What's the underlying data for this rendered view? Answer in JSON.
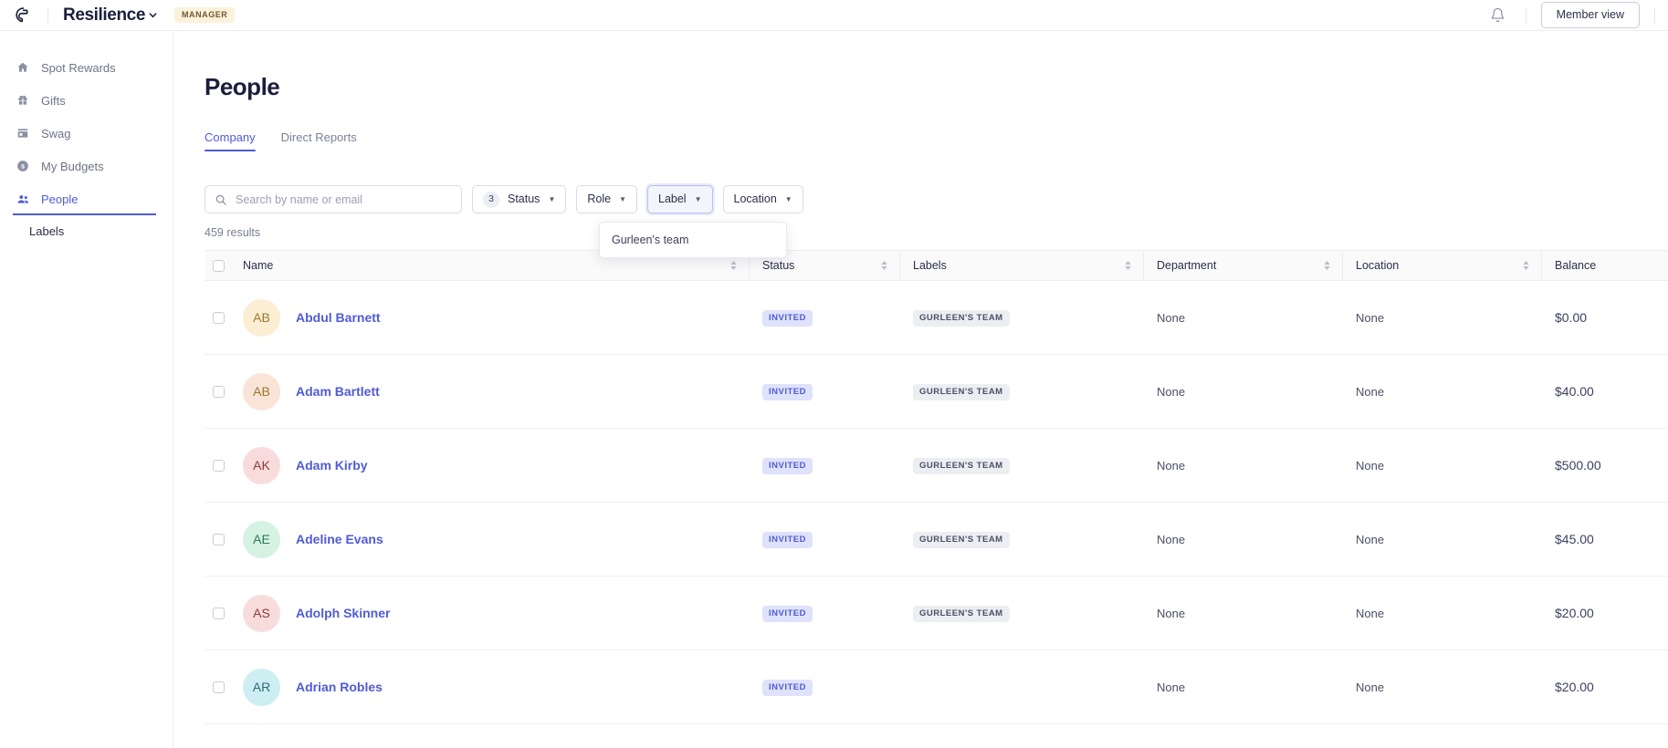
{
  "topbar": {
    "logo_icon": "resilience-logo-icon",
    "brand_name": "Resilience",
    "brand_caret_icon": "chevron-down-icon",
    "role_pill": "MANAGER",
    "bell_icon": "notification-bell-icon",
    "member_view_label": "Member view"
  },
  "sidebar": {
    "items": [
      {
        "label": "Spot Rewards",
        "icon": "home-icon",
        "active": false
      },
      {
        "label": "Gifts",
        "icon": "gift-icon",
        "active": false
      },
      {
        "label": "Swag",
        "icon": "store-icon",
        "active": false
      },
      {
        "label": "My Budgets",
        "icon": "dollar-circle-icon",
        "active": false
      },
      {
        "label": "People",
        "icon": "people-icon",
        "active": true
      }
    ],
    "sub_item": "Labels"
  },
  "page": {
    "title": "People",
    "tabs": [
      {
        "label": "Company",
        "active": true
      },
      {
        "label": "Direct Reports",
        "active": false
      }
    ]
  },
  "filters": {
    "search": {
      "placeholder": "Search by name or email",
      "value": "",
      "icon": "search-icon"
    },
    "status": {
      "label": "Status",
      "count": "3",
      "caret_icon": "caret-down-icon"
    },
    "role": {
      "label": "Role",
      "caret_icon": "caret-down-icon"
    },
    "label": {
      "label": "Label",
      "caret_icon": "caret-down-icon",
      "open": true
    },
    "location": {
      "label": "Location",
      "caret_icon": "caret-down-icon"
    },
    "dropdown_items": [
      "Gurleen's team"
    ]
  },
  "results_count": "459 results",
  "table": {
    "headers": {
      "name": "Name",
      "status": "Status",
      "labels": "Labels",
      "department": "Department",
      "location": "Location",
      "balance": "Balance"
    },
    "rows": [
      {
        "initials": "AB",
        "name": "Abdul Barnett",
        "status": "INVITED",
        "label": "GURLEEN'S TEAM",
        "department": "None",
        "location": "None",
        "balance": "$0.00",
        "avatar_bg": "#fbeed3",
        "avatar_fg": "#9a7a2e"
      },
      {
        "initials": "AB",
        "name": "Adam Bartlett",
        "status": "INVITED",
        "label": "GURLEEN'S TEAM",
        "department": "None",
        "location": "None",
        "balance": "$40.00",
        "avatar_bg": "#fae4d7",
        "avatar_fg": "#9a7a2e"
      },
      {
        "initials": "AK",
        "name": "Adam Kirby",
        "status": "INVITED",
        "label": "GURLEEN'S TEAM",
        "department": "None",
        "location": "None",
        "balance": "$500.00",
        "avatar_bg": "#f8dcdc",
        "avatar_fg": "#8e3b3b"
      },
      {
        "initials": "AE",
        "name": "Adeline Evans",
        "status": "INVITED",
        "label": "GURLEEN'S TEAM",
        "department": "None",
        "location": "None",
        "balance": "$45.00",
        "avatar_bg": "#d6f2e3",
        "avatar_fg": "#2e7a55"
      },
      {
        "initials": "AS",
        "name": "Adolph Skinner",
        "status": "INVITED",
        "label": "GURLEEN'S TEAM",
        "department": "None",
        "location": "None",
        "balance": "$20.00",
        "avatar_bg": "#f8dcdc",
        "avatar_fg": "#8e3b3b"
      },
      {
        "initials": "AR",
        "name": "Adrian Robles",
        "status": "INVITED",
        "label": "",
        "department": "None",
        "location": "None",
        "balance": "$20.00",
        "avatar_bg": "#cdeef2",
        "avatar_fg": "#2b6b77"
      }
    ]
  },
  "colors": {
    "accent": "#4f5bd5",
    "brand_dark": "#1b1f3b",
    "role_pill_bg": "#fcf1da",
    "badge_invited_bg": "#dfe2fb",
    "badge_label_bg": "#eceef2"
  }
}
